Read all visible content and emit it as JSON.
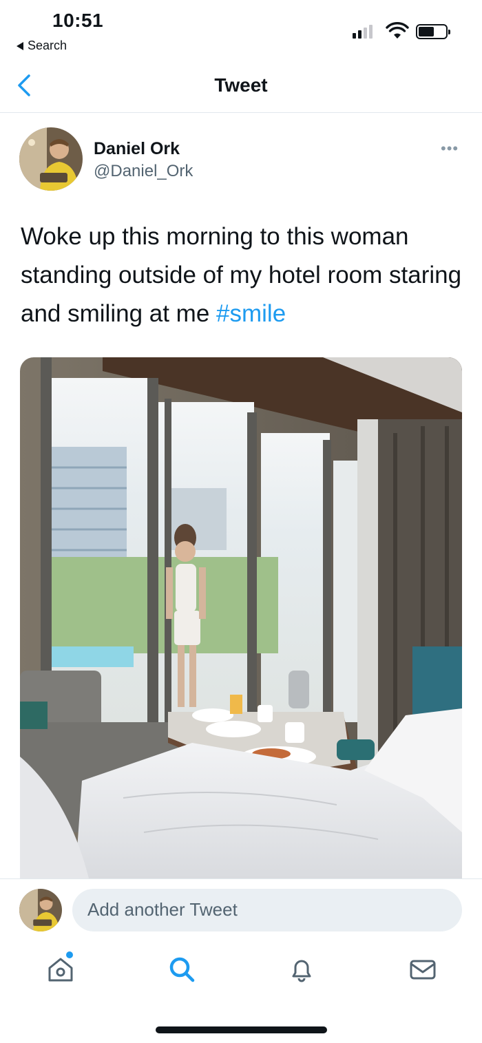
{
  "status_bar": {
    "time": "10:51",
    "back_app_label": "Search",
    "signal_icon": "cellular-signal-icon",
    "wifi_icon": "wifi-icon",
    "battery_icon": "battery-icon",
    "battery_level": 0.5
  },
  "nav": {
    "back_icon": "chevron-left-icon",
    "title": "Tweet"
  },
  "tweet": {
    "author": {
      "display_name": "Daniel Ork",
      "handle": "@Daniel_Ork"
    },
    "more_icon": "more-horizontal-icon",
    "text": "Woke up this morning to this woman standing outside of my hotel room staring and smiling at me",
    "hashtag": "#smile",
    "media_icon": "photo-hotel-room-window"
  },
  "reply": {
    "placeholder": "Add another Tweet"
  },
  "tabbar": {
    "items": [
      {
        "name": "home",
        "icon": "home-icon",
        "has_notification_dot": true
      },
      {
        "name": "search",
        "icon": "search-icon",
        "active": true
      },
      {
        "name": "notifications",
        "icon": "bell-icon"
      },
      {
        "name": "messages",
        "icon": "mail-icon"
      }
    ]
  },
  "colors": {
    "accent": "#1d9bf0",
    "text_primary": "#0f1419",
    "text_secondary": "#536471",
    "divider": "#e1e8ed",
    "input_bg": "#eaeff3"
  }
}
